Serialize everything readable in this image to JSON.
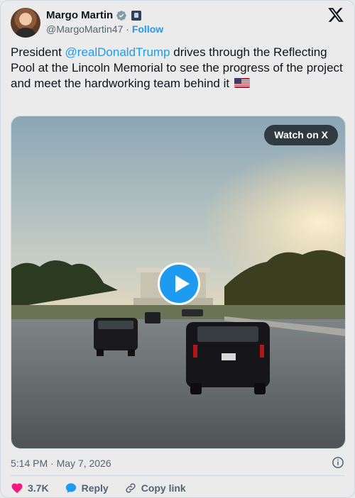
{
  "author": {
    "name": "Margo Martin",
    "handle": "@MargoMartin47",
    "separator": "·",
    "follow_label": "Follow"
  },
  "tweet": {
    "text_before": "President ",
    "mention": "@realDonaldTrump",
    "text_after": " drives through the Reflecting Pool at the Lincoln Memorial to see the progress of the project and meet the hardworking team behind it",
    "emoji": "us-flag-emoji"
  },
  "media": {
    "watch_label": "Watch on X",
    "play_icon": "play-icon"
  },
  "meta": {
    "timestamp": "5:14 PM · May 7, 2026"
  },
  "actions": {
    "likes_count": "3.7K",
    "reply_label": "Reply",
    "copy_link_label": "Copy link"
  },
  "colors": {
    "accent": "#1d9bf0",
    "like": "#f91880",
    "text": "#0f1419",
    "muted": "#536471"
  }
}
